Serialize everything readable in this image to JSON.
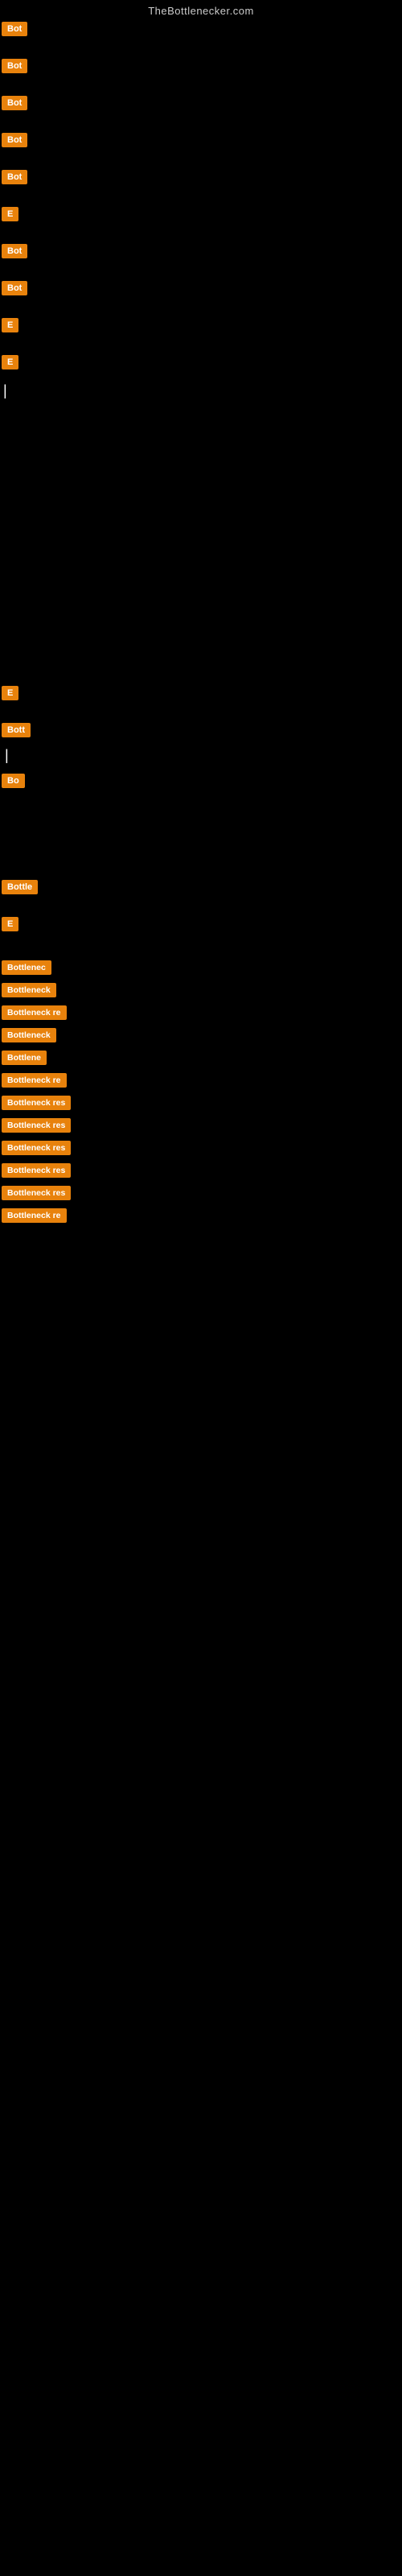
{
  "site": {
    "title": "TheBottlenecker.com"
  },
  "top_items": [
    {
      "id": "btn1",
      "label": "Bot"
    },
    {
      "id": "btn2",
      "label": "Bot"
    },
    {
      "id": "btn3",
      "label": "Bot"
    },
    {
      "id": "btn4",
      "label": "Bot"
    },
    {
      "id": "btn5",
      "label": "Bot"
    },
    {
      "id": "btn6",
      "label": "E"
    },
    {
      "id": "btn7",
      "label": "Bot"
    },
    {
      "id": "btn8",
      "label": "Bot"
    },
    {
      "id": "btn9",
      "label": "E"
    },
    {
      "id": "btn10",
      "label": "E"
    }
  ],
  "pipe_label": "|",
  "middle_items": [
    {
      "id": "mid1",
      "label": "E"
    },
    {
      "id": "mid2",
      "label": "Bott"
    },
    {
      "id": "mid3",
      "label": "|"
    },
    {
      "id": "mid4",
      "label": "Bo"
    }
  ],
  "lower_items": [
    {
      "id": "low1",
      "label": "Bottle"
    },
    {
      "id": "low2",
      "label": "E"
    }
  ],
  "list_items": [
    {
      "id": "li1",
      "label": "Bottlenec"
    },
    {
      "id": "li2",
      "label": "Bottleneck"
    },
    {
      "id": "li3",
      "label": "Bottleneck re"
    },
    {
      "id": "li4",
      "label": "Bottleneck"
    },
    {
      "id": "li5",
      "label": "Bottlene"
    },
    {
      "id": "li6",
      "label": "Bottleneck re"
    },
    {
      "id": "li7",
      "label": "Bottleneck res"
    },
    {
      "id": "li8",
      "label": "Bottleneck res"
    },
    {
      "id": "li9",
      "label": "Bottleneck res"
    },
    {
      "id": "li10",
      "label": "Bottleneck res"
    },
    {
      "id": "li11",
      "label": "Bottleneck res"
    },
    {
      "id": "li12",
      "label": "Bottleneck re"
    }
  ]
}
